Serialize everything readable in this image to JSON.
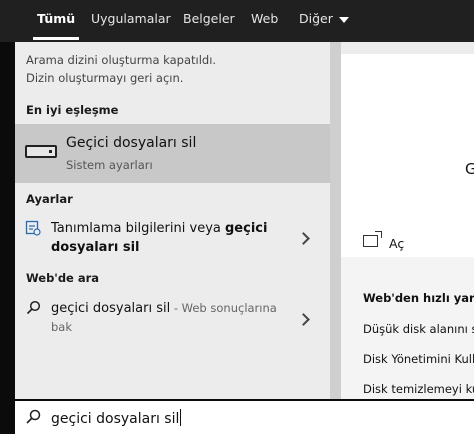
{
  "tabs": [
    {
      "label": "Tümü"
    },
    {
      "label": "Uygulamalar"
    },
    {
      "label": "Belgeler"
    },
    {
      "label": "Web"
    },
    {
      "label": "Diğer"
    }
  ],
  "notice": {
    "line1": "Arama dizini oluşturma kapatıldı.",
    "line2": "Dizin oluşturmayı geri açın."
  },
  "best_match": {
    "header": "En iyi eşleşme",
    "title": "Geçici dosyaları sil",
    "subtitle": "Sistem ayarları",
    "icon": "drive-icon"
  },
  "settings": {
    "header": "Ayarlar",
    "item_prefix": "Tanımlama bilgilerini veya ",
    "item_highlight_1": "geçici",
    "item_highlight_2": "dosyaları sil",
    "icon": "settings-sync-icon"
  },
  "web": {
    "header": "Web'de ara",
    "query": "geçici dosyaları sil",
    "suffix": " - Web sonuçlarına",
    "suffix2": "bak",
    "icon": "search-icon"
  },
  "preview": {
    "cut_text": "G",
    "open_label": "Aç",
    "quick_header": "Web'den hızlı yardım",
    "quick_links": [
      "Düşük disk alanını sal",
      "Disk Yönetimini Kulla",
      "Disk temizlemeyi kull"
    ]
  },
  "search": {
    "value": "geçici dosyaları sil"
  },
  "colors": {
    "topbar": "#202020",
    "panel": "#ececec",
    "selected": "#c8c8c8"
  }
}
